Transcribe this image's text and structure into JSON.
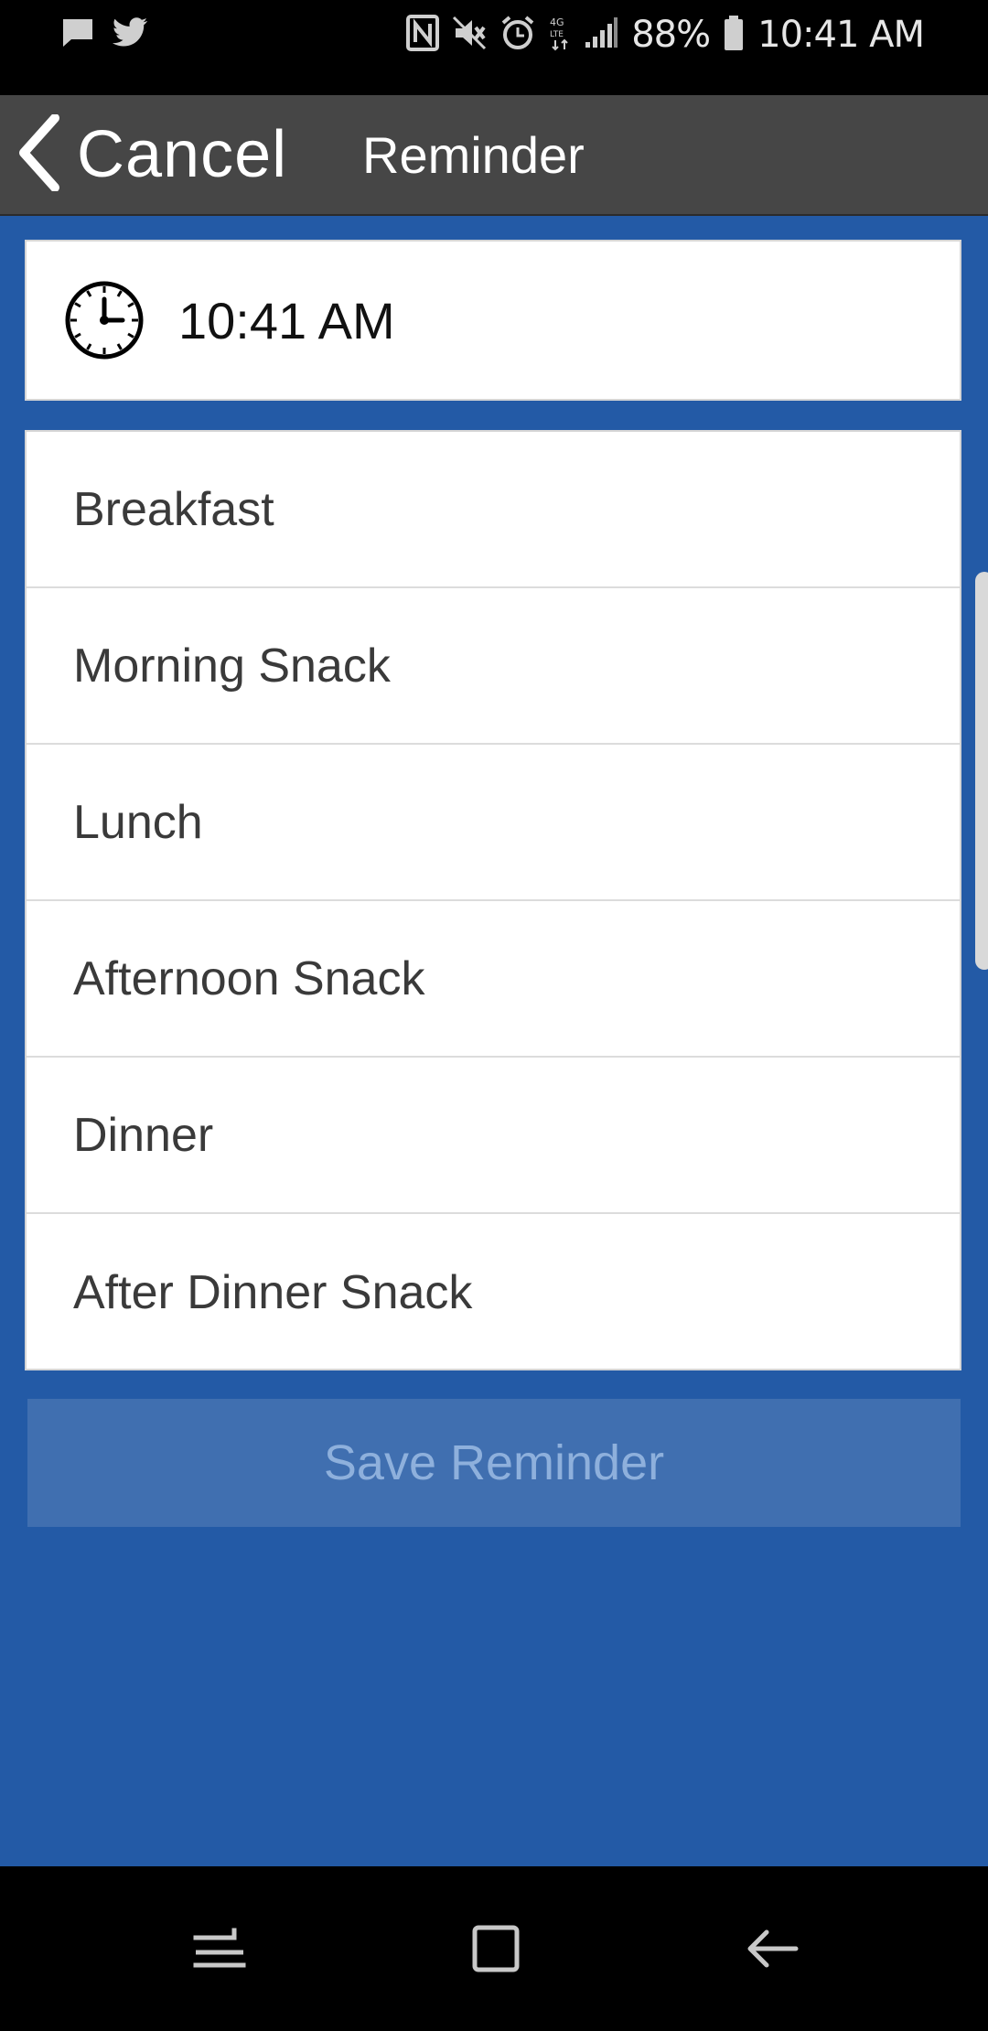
{
  "status_bar": {
    "battery": "88%",
    "time": "10:41 AM",
    "left_icons": [
      "message-icon",
      "twitter-icon"
    ],
    "right_icons": [
      "nfc-icon",
      "mute-icon",
      "alarm-icon",
      "lte-icon",
      "signal-icon",
      "battery-icon"
    ]
  },
  "header": {
    "back_label": "Cancel",
    "title": "Reminder"
  },
  "time_picker": {
    "icon": "clock-icon",
    "value": "10:41 AM"
  },
  "meals": [
    {
      "label": "Breakfast"
    },
    {
      "label": "Morning Snack"
    },
    {
      "label": "Lunch"
    },
    {
      "label": "Afternoon Snack"
    },
    {
      "label": "Dinner"
    },
    {
      "label": "After Dinner Snack"
    }
  ],
  "save_button": {
    "label": "Save Reminder",
    "enabled": false
  },
  "nav_bar": {
    "icons": [
      "recent-apps-icon",
      "home-icon",
      "back-icon"
    ]
  },
  "colors": {
    "background": "#235aa6",
    "app_bar": "#464646",
    "save_button_disabled": "#406fb0",
    "save_text_disabled": "#8eb0dc"
  }
}
